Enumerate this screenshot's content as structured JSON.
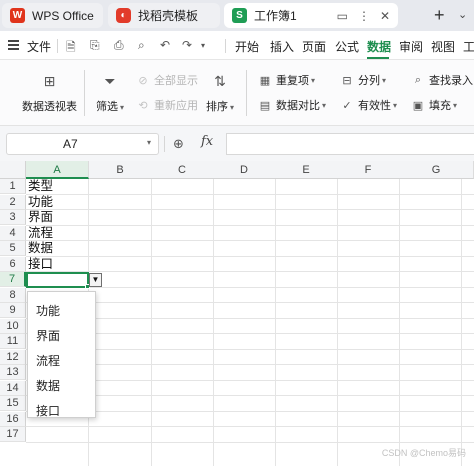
{
  "tabs": {
    "wps": {
      "icon": "wps-logo-icon",
      "label": "WPS Office"
    },
    "template": {
      "icon": "template-logo-icon",
      "label": "找稻壳模板"
    },
    "document": {
      "icon": "sheet-logo-icon",
      "icon_letter": "S",
      "label": "工作簿1"
    },
    "new_tab": "+"
  },
  "menubar": {
    "file": "文件",
    "items": [
      "开始",
      "插入",
      "页面",
      "公式",
      "数据",
      "审阅",
      "视图",
      "工"
    ],
    "active": "数据",
    "accent": "#1e8e4f"
  },
  "ribbon": {
    "pivot": "数据透视表",
    "filter": "筛选",
    "show_all": "全部显示",
    "reapply": "重新应用",
    "sort": "排序",
    "duplicates": "重复项",
    "compare": "数据对比",
    "split": "分列",
    "validation": "有效性",
    "find_entry": "查找录入",
    "fill": "填充"
  },
  "formula_bar": {
    "cell_ref": "A7",
    "fx": "fx",
    "value": ""
  },
  "sheet": {
    "columns": [
      "A",
      "B",
      "C",
      "D",
      "E",
      "F",
      "G"
    ],
    "rows": [
      "1",
      "2",
      "3",
      "4",
      "5",
      "6",
      "7",
      "8",
      "9",
      "10",
      "11",
      "12",
      "13",
      "14",
      "15",
      "16",
      "17"
    ],
    "active_column": "A",
    "active_row": "7",
    "cells_a": [
      "类型",
      "功能",
      "界面",
      "流程",
      "数据",
      "接口"
    ]
  },
  "dropdown": {
    "options": [
      "功能",
      "界面",
      "流程",
      "数据",
      "接口"
    ]
  },
  "watermark": "CSDN @Chemo易码"
}
